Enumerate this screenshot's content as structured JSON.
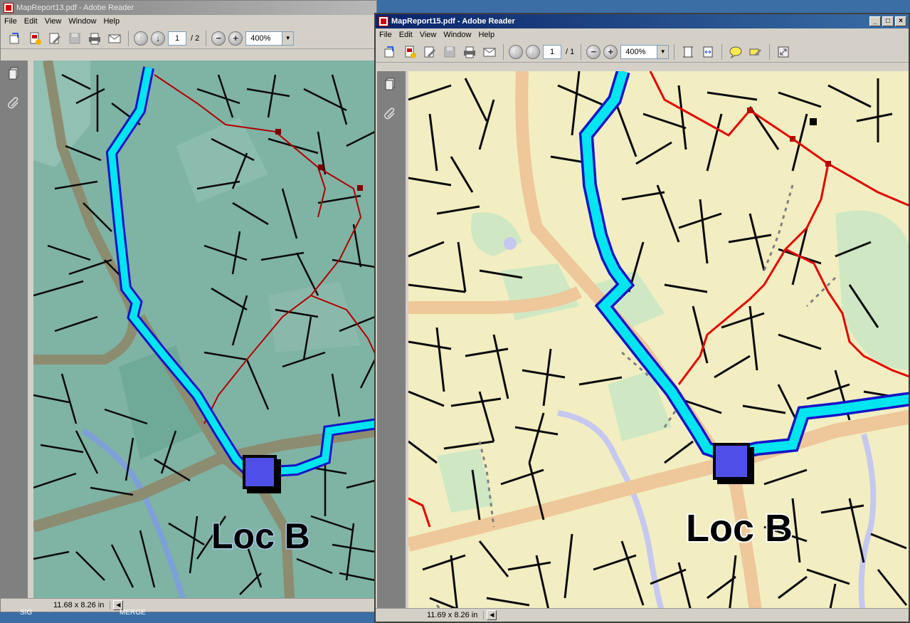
{
  "background_window": {
    "title": "MapReport13.pdf - Adobe Reader",
    "menu": [
      "File",
      "Edit",
      "View",
      "Window",
      "Help"
    ],
    "page_current": "1",
    "page_total": "/ 2",
    "zoom": "400%",
    "page_size": "11.68 x 8.26 in",
    "map_label": "Loc B",
    "taskbar_left": "SIG",
    "taskbar_mid": "MERGE"
  },
  "active_window": {
    "title": "MapReport15.pdf - Adobe Reader",
    "menu": [
      "File",
      "Edit",
      "View",
      "Window",
      "Help"
    ],
    "page_current": "1",
    "page_total": "/ 1",
    "zoom": "400%",
    "page_size": "11.69 x 8.26 in",
    "map_label": "Loc B",
    "window_buttons": [
      "_",
      "□",
      "×"
    ]
  },
  "colors": {
    "map1_background": "#7fb3a4",
    "map2_background": "#f2eec2",
    "route_fill": "#00e5f0",
    "route_outline": "#1414c8",
    "boundary_red": "#e00000",
    "major_road_1": "#8c8c70",
    "major_road_2": "#eec79a",
    "marker": "#4f4fe8"
  }
}
